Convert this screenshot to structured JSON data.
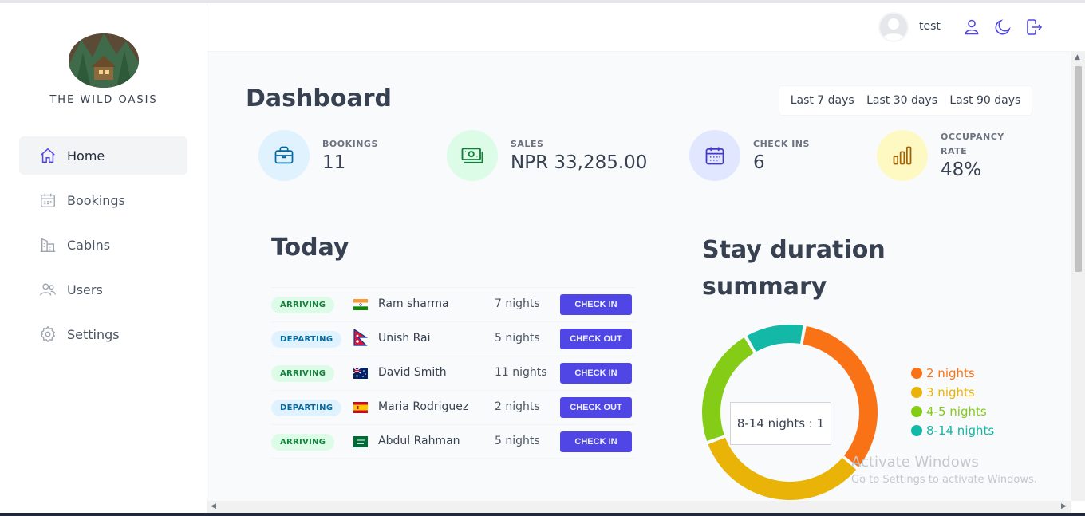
{
  "brand": {
    "name": "THE WILD OASIS"
  },
  "sidebar": {
    "items": [
      {
        "label": "Home",
        "icon": "home-icon",
        "active": true
      },
      {
        "label": "Bookings",
        "icon": "calendar-icon",
        "active": false
      },
      {
        "label": "Cabins",
        "icon": "building-icon",
        "active": false
      },
      {
        "label": "Users",
        "icon": "users-icon",
        "active": false
      },
      {
        "label": "Settings",
        "icon": "gear-icon",
        "active": false
      }
    ]
  },
  "header": {
    "username": "test",
    "icons": [
      "user-icon",
      "moon-icon",
      "logout-icon"
    ]
  },
  "dashboard": {
    "title": "Dashboard",
    "filters": [
      "Last 7 days",
      "Last 30 days",
      "Last 90 days"
    ],
    "stats": [
      {
        "label": "BOOKINGS",
        "value": "11",
        "icon": "briefcase-icon",
        "color": "#e0f2fe"
      },
      {
        "label": "SALES",
        "value": "NPR 33,285.00",
        "icon": "banknotes-icon",
        "color": "#dcfce7"
      },
      {
        "label": "CHECK INS",
        "value": "6",
        "icon": "calendar-days-icon",
        "color": "#e0e7ff"
      },
      {
        "label": "OCCUPANCY",
        "label2": "RATE",
        "value": "48%",
        "icon": "chart-bar-icon",
        "color": "#fef9c3"
      }
    ]
  },
  "today": {
    "title": "Today",
    "rows": [
      {
        "status": "ARRIVING",
        "flag": "india",
        "name": "Ram sharma",
        "nights": "7 nights",
        "action": "CHECK IN"
      },
      {
        "status": "DEPARTING",
        "flag": "nepal",
        "name": "Unish Rai",
        "nights": "5 nights",
        "action": "CHECK OUT"
      },
      {
        "status": "ARRIVING",
        "flag": "australia",
        "name": "David Smith",
        "nights": "11 nights",
        "action": "CHECK IN"
      },
      {
        "status": "DEPARTING",
        "flag": "spain",
        "name": "Maria Rodriguez",
        "nights": "2 nights",
        "action": "CHECK OUT"
      },
      {
        "status": "ARRIVING",
        "flag": "saudi-arabia",
        "name": "Abdul Rahman",
        "nights": "5 nights",
        "action": "CHECK IN"
      }
    ]
  },
  "stay": {
    "title": "Stay duration summary",
    "tooltip": "8-14 nights : 1",
    "legend": [
      {
        "label": "2 nights",
        "color": "#f97316"
      },
      {
        "label": "3 nights",
        "color": "#eab308"
      },
      {
        "label": "4-5 nights",
        "color": "#84cc16"
      },
      {
        "label": "8-14 nights",
        "color": "#14b8a6"
      }
    ]
  },
  "chart_data": {
    "type": "pie",
    "categories": [
      "2 nights",
      "3 nights",
      "4-5 nights",
      "8-14 nights"
    ],
    "values": [
      3,
      3,
      2,
      1
    ],
    "colors": [
      "#f97316",
      "#eab308",
      "#84cc16",
      "#14b8a6"
    ]
  },
  "watermark": {
    "line1": "Activate Windows",
    "line2": "Go to Settings to activate Windows."
  }
}
